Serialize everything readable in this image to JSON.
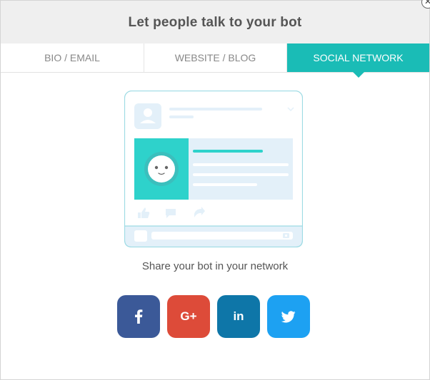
{
  "dialog": {
    "title": "Let people talk to your bot",
    "close_icon": "close-icon"
  },
  "tabs": [
    {
      "label": "BIO / EMAIL",
      "active": false
    },
    {
      "label": "WEBSITE / BLOG",
      "active": false
    },
    {
      "label": "SOCIAL NETWORK",
      "active": true
    }
  ],
  "share": {
    "text": "Share your bot in your network"
  },
  "social_buttons": [
    {
      "network": "facebook",
      "glyph": "f",
      "color": "#3b5998"
    },
    {
      "network": "google-plus",
      "glyph": "G+",
      "color": "#dd4b39"
    },
    {
      "network": "linkedin",
      "glyph": "in",
      "color": "#0e76a8"
    },
    {
      "network": "twitter",
      "glyph": "twitter-bird",
      "color": "#1da1f2"
    }
  ],
  "colors": {
    "accent": "#1abcb6",
    "header_bg": "#efefef",
    "illustration_light": "#e3f0f9",
    "illustration_border": "#9ddbe4"
  }
}
